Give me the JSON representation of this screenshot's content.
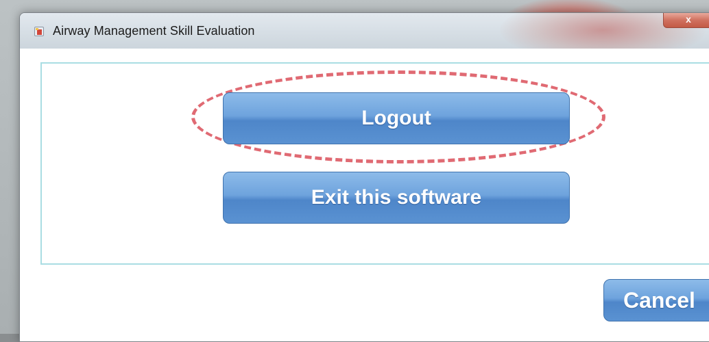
{
  "window": {
    "title": "Airway Management Skill Evaluation",
    "close_glyph": "x",
    "app_icon": "app-icon"
  },
  "dialog": {
    "logout_label": "Logout",
    "exit_label": "Exit this software",
    "cancel_label": "Cancel"
  },
  "colors": {
    "button_blue": "#5a92d2",
    "panel_border": "#a9dde3",
    "highlight_dashed": "#e06a73"
  }
}
